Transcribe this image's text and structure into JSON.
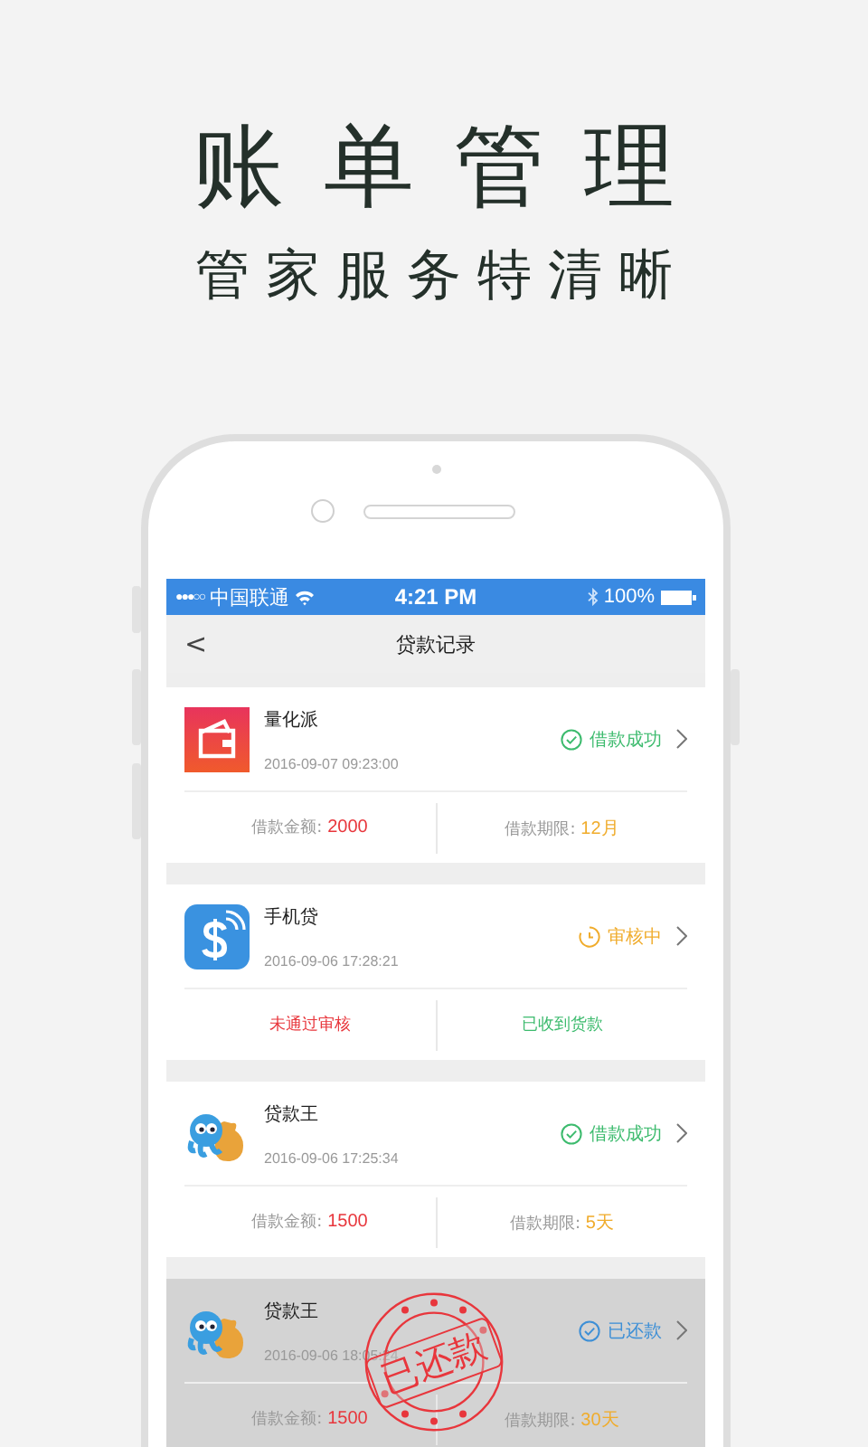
{
  "headline": {
    "title": "账单管理",
    "subtitle": "管家服务特清晰"
  },
  "status_bar": {
    "signal": "●●●○○",
    "carrier": "中国联通",
    "time": "4:21 PM",
    "battery": "100%"
  },
  "nav": {
    "back": "<",
    "title": "贷款记录"
  },
  "loans": [
    {
      "kind": "wallet",
      "name": "量化派",
      "time": "2016-09-07 09:23:00",
      "status": {
        "kind": "success",
        "text": "借款成功"
      },
      "repaid": false,
      "bottom": {
        "kind": "terms",
        "amount_label": "借款金额:",
        "amount": "2000",
        "period_label": "借款期限:",
        "period": "12月"
      }
    },
    {
      "kind": "dollar",
      "name": "手机贷",
      "time": "2016-09-06 17:28:21",
      "status": {
        "kind": "pending",
        "text": "审核中"
      },
      "repaid": false,
      "bottom": {
        "kind": "notes",
        "left": "未通过审核",
        "right": "已收到货款"
      }
    },
    {
      "kind": "octopus",
      "name": "贷款王",
      "time": "2016-09-06 17:25:34",
      "status": {
        "kind": "success",
        "text": "借款成功"
      },
      "repaid": false,
      "bottom": {
        "kind": "terms",
        "amount_label": "借款金额:",
        "amount": "1500",
        "period_label": "借款期限:",
        "period": "5天"
      }
    },
    {
      "kind": "octopus",
      "name": "贷款王",
      "time": "2016-09-06 18:05:24",
      "status": {
        "kind": "repaid",
        "text": "已还款"
      },
      "repaid": true,
      "stamp": "已还款",
      "bottom": {
        "kind": "terms",
        "amount_label": "借款金额:",
        "amount": "1500",
        "period_label": "借款期限:",
        "period": "30天"
      }
    }
  ]
}
